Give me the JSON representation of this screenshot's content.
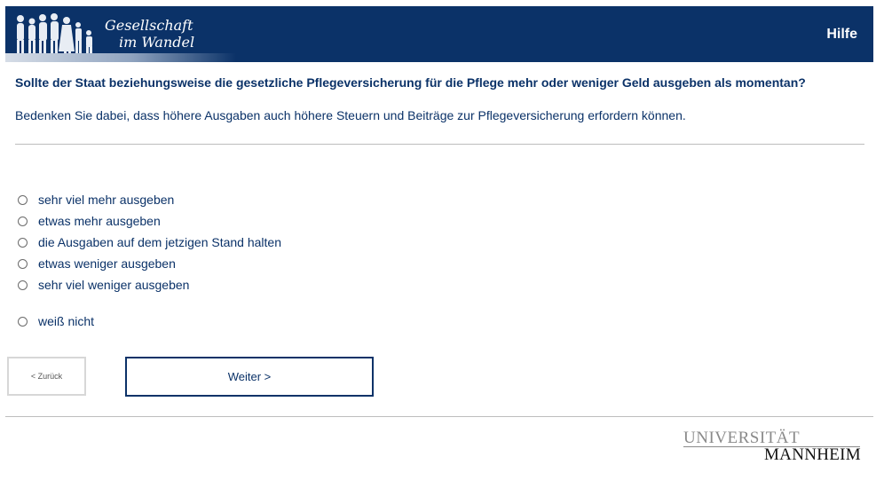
{
  "header": {
    "logo_line1": "Gesellschaft",
    "logo_line2": "im Wandel",
    "help_label": "Hilfe",
    "bg_color": "#0b3268"
  },
  "question": {
    "text": "Sollte der Staat beziehungsweise die gesetzliche Pflegeversicherung für die Pflege mehr oder weniger Geld ausgeben als momentan?",
    "note": "Bedenken Sie dabei, dass höhere Ausgaben auch höhere Steuern und Beiträge zur Pflegeversicherung erfordern können."
  },
  "options": [
    {
      "label": "sehr viel mehr ausgeben",
      "selected": false
    },
    {
      "label": "etwas mehr ausgeben",
      "selected": false
    },
    {
      "label": "die Ausgaben auf dem jetzigen Stand halten",
      "selected": false
    },
    {
      "label": "etwas weniger ausgeben",
      "selected": false
    },
    {
      "label": "sehr viel weniger ausgeben",
      "selected": false
    },
    {
      "label": "weiß nicht",
      "selected": false
    }
  ],
  "nav": {
    "back_label": "< Zurück",
    "next_label": "Weiter >"
  },
  "footer": {
    "logo_top": "UNIVERSITÄT",
    "logo_bottom": "MANNHEIM"
  }
}
